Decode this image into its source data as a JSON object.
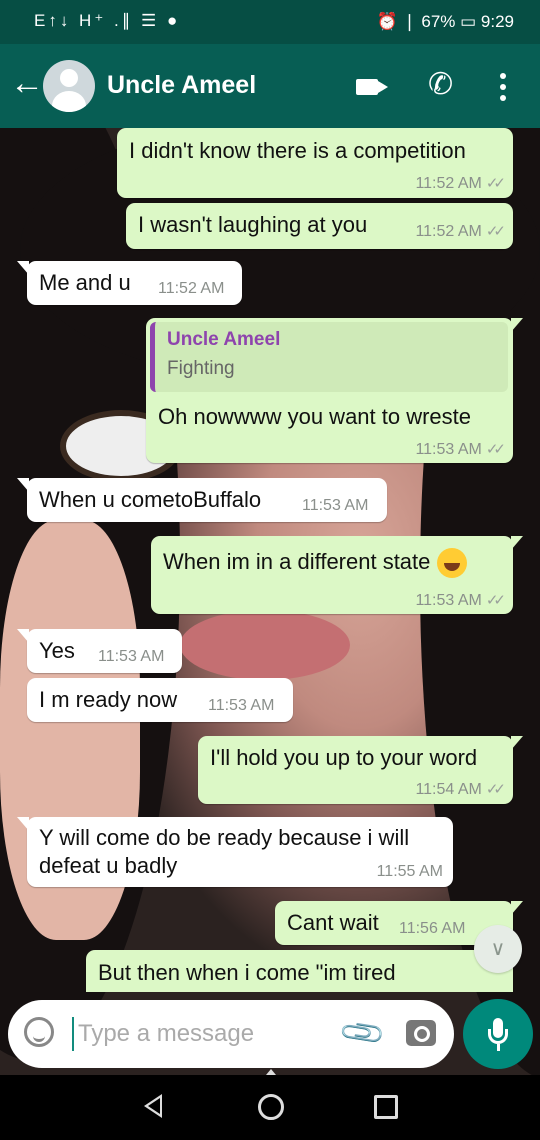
{
  "status_bar": {
    "left_icons": "E↑↓ H⁺ .∥ ☰ ●",
    "right_text": "⏰ ❘ 67% ▭ 9:29"
  },
  "header": {
    "contact_name": "Uncle Ameel",
    "icons": [
      "back-arrow-icon",
      "video-call-icon",
      "phone-icon",
      "more-options-icon"
    ]
  },
  "messages": [
    {
      "dir": "out",
      "text": "I didn't know there is a competition",
      "time": "11:52 AM",
      "ticks": "✓✓"
    },
    {
      "dir": "out",
      "text": "I wasn't laughing at you",
      "time": "11:52 AM",
      "ticks": "✓✓"
    },
    {
      "dir": "in",
      "text": "Me and u",
      "time": "11:52 AM"
    },
    {
      "dir": "out",
      "quote_name": "Uncle Ameel",
      "quote_text": "Fighting",
      "text": "Oh nowwww you want to wreste",
      "time": "11:53 AM",
      "ticks": "✓✓"
    },
    {
      "dir": "in",
      "text": "When u cometoBuffalo",
      "time": "11:53 AM"
    },
    {
      "dir": "out",
      "text": "When im in a different state",
      "emoji": "face-with-tears-of-joy-emoji",
      "time": "11:53 AM",
      "ticks": "✓✓"
    },
    {
      "dir": "in",
      "text": "Yes",
      "time": "11:53 AM"
    },
    {
      "dir": "in",
      "text": "I m ready now",
      "time": "11:53 AM"
    },
    {
      "dir": "out",
      "text": "I'll hold you up to your word",
      "time": "11:54 AM",
      "ticks": "✓✓"
    },
    {
      "dir": "in",
      "text_line1": "Y will come do be ready because i will",
      "text_line2": "defeat u badly",
      "time": "11:55 AM"
    },
    {
      "dir": "out",
      "text": "Cant wait",
      "time": "11:56 AM"
    },
    {
      "dir": "out",
      "text": "But then when i come \"im tired"
    }
  ],
  "composer": {
    "placeholder": "Type a message",
    "icons": [
      "emoji-icon",
      "attach-icon",
      "camera-icon",
      "mic-icon"
    ]
  },
  "colors": {
    "header": "#075e54",
    "status_bar": "#064e44",
    "outgoing_bubble": "#dcf8c6",
    "incoming_bubble": "#ffffff",
    "accent": "#00897b",
    "quote_name": "#8e44ad"
  }
}
